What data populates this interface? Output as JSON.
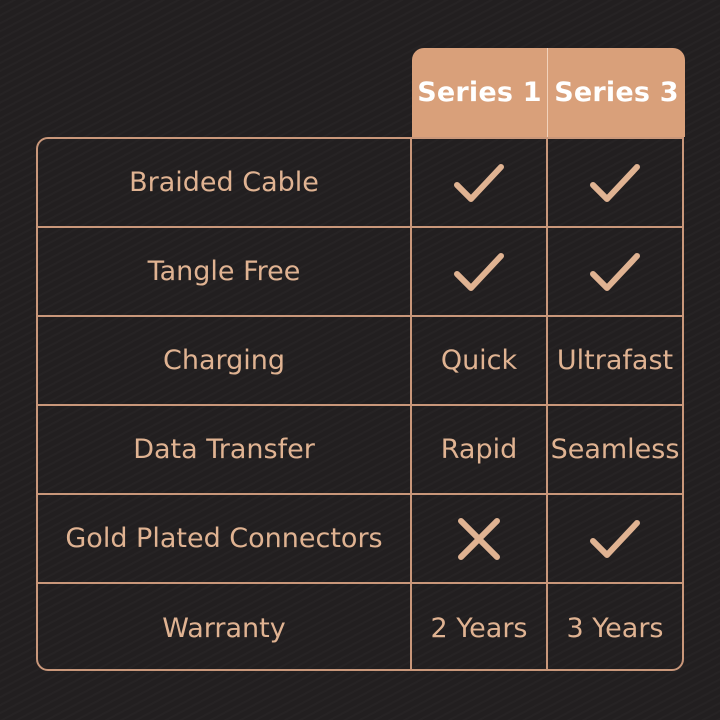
{
  "header": {
    "series1": "Series 1",
    "series3": "Series 3"
  },
  "colors": {
    "background": "#221f20",
    "accent": "#d9a07a",
    "text": "#e0b392",
    "line": "#c9977a"
  },
  "rows": [
    {
      "label": "Braided Cable",
      "series1": "check-icon",
      "series3": "check-icon"
    },
    {
      "label": "Tangle Free",
      "series1": "check-icon",
      "series3": "check-icon"
    },
    {
      "label": "Charging",
      "series1": "Quick",
      "series3": "Ultrafast"
    },
    {
      "label": "Data Transfer",
      "series1": "Rapid",
      "series3": "Seamless"
    },
    {
      "label": "Gold Plated Connectors",
      "series1": "cross-icon",
      "series3": "check-icon"
    },
    {
      "label": "Warranty",
      "series1": "2 Years",
      "series3": "3 Years"
    }
  ]
}
